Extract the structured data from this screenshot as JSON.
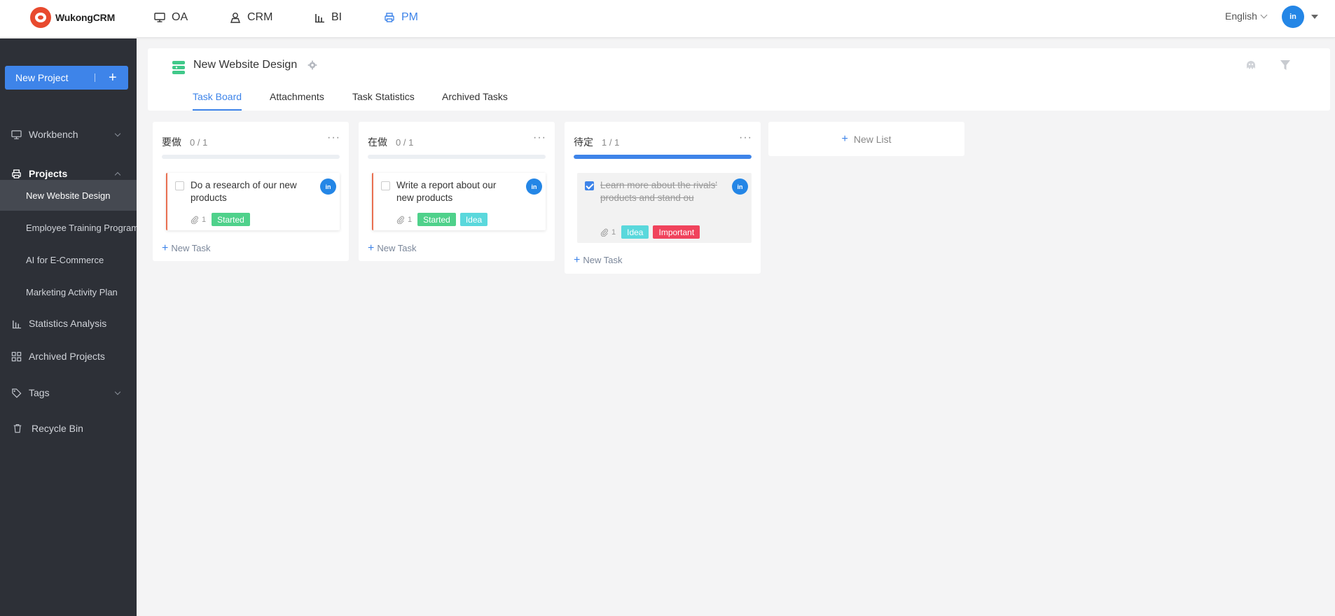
{
  "app": {
    "logo_text": "WukongCRM",
    "nav": [
      {
        "label": "OA",
        "icon": "monitor-icon"
      },
      {
        "label": "CRM",
        "icon": "user-icon"
      },
      {
        "label": "BI",
        "icon": "bar-chart-icon"
      },
      {
        "label": "PM",
        "icon": "printer-icon",
        "active": true
      }
    ],
    "language": "English",
    "avatar_text": "in"
  },
  "sidebar": {
    "new_project_label": "New Project",
    "items": [
      {
        "label": "Workbench",
        "icon": "monitor-icon",
        "expandable": true
      },
      {
        "label": "Projects",
        "icon": "folder-icon",
        "expanded": true
      },
      {
        "label": "Statistics Analysis",
        "icon": "bar-chart-icon"
      },
      {
        "label": "Archived Projects",
        "icon": "grid-icon"
      },
      {
        "label": "Tags",
        "icon": "tag-icon",
        "expandable": true
      },
      {
        "label": "Recycle Bin",
        "icon": "trash-icon"
      }
    ],
    "projects": [
      {
        "label": "New Website Design",
        "active": true
      },
      {
        "label": "Employee Training Program"
      },
      {
        "label": "AI for E-Commerce"
      },
      {
        "label": "Marketing Activity Plan"
      }
    ]
  },
  "project": {
    "title": "New Website Design",
    "tabs": [
      {
        "label": "Task Board",
        "active": true
      },
      {
        "label": "Attachments"
      },
      {
        "label": "Task Statistics"
      },
      {
        "label": "Archived Tasks"
      }
    ]
  },
  "board": {
    "new_task_label": "New Task",
    "new_list_label": "New List",
    "columns": [
      {
        "name": "要做",
        "count": "0 / 1",
        "progress": 0,
        "tasks": [
          {
            "title": "Do a research of our new products",
            "done": false,
            "attachments": "1",
            "avatar": "in",
            "tags": [
              {
                "label": "Started",
                "color": "#4fd18b"
              }
            ]
          }
        ]
      },
      {
        "name": "在做",
        "count": "0 / 1",
        "progress": 0,
        "tasks": [
          {
            "title": "Write a report about our new products",
            "done": false,
            "attachments": "1",
            "avatar": "in",
            "tags": [
              {
                "label": "Started",
                "color": "#4fd18b"
              },
              {
                "label": "Idea",
                "color": "#5ad8dc"
              }
            ]
          }
        ]
      },
      {
        "name": "待定",
        "count": "1 / 1",
        "progress": 1,
        "tasks": [
          {
            "title": "Learn more about the rivals' products and stand ou",
            "done": true,
            "attachments": "1",
            "avatar": "in",
            "tags": [
              {
                "label": "Idea",
                "color": "#5ad8dc"
              },
              {
                "label": "Important",
                "color": "#f0435c"
              }
            ]
          }
        ]
      }
    ]
  }
}
